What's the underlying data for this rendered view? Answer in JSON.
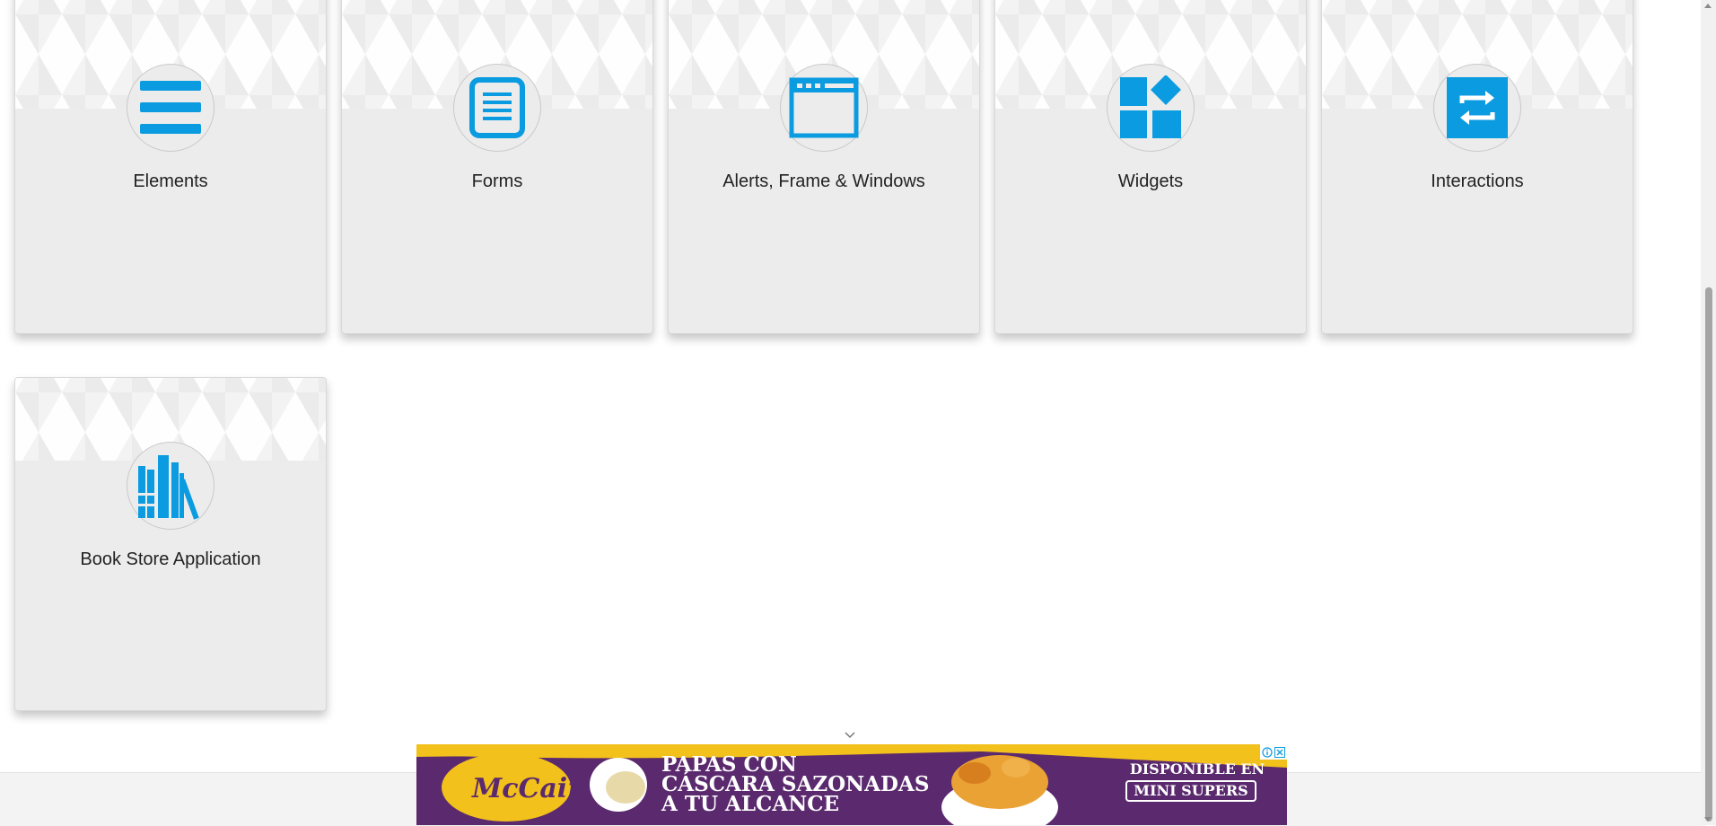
{
  "cards": [
    {
      "label": "Elements",
      "icon": "elements-icon"
    },
    {
      "label": "Forms",
      "icon": "forms-icon"
    },
    {
      "label": "Alerts, Frame & Windows",
      "icon": "alerts-window-icon"
    },
    {
      "label": "Widgets",
      "icon": "widgets-icon"
    },
    {
      "label": "Interactions",
      "icon": "interactions-icon"
    },
    {
      "label": "Book Store Application",
      "icon": "bookstore-icon"
    }
  ],
  "ad": {
    "brand": "McCain",
    "headline": [
      "PAPAS CON",
      "CÁSCARA SAZONADAS",
      "A TU ALCANCE"
    ],
    "availability": "DISPONIBLE EN",
    "cta": "MINI SUPERS"
  },
  "colors": {
    "accent": "#0A9BE0",
    "card_bg": "#ECECEC",
    "ad_bg": "#5B2A6E",
    "ad_yellow": "#F2C11C"
  }
}
